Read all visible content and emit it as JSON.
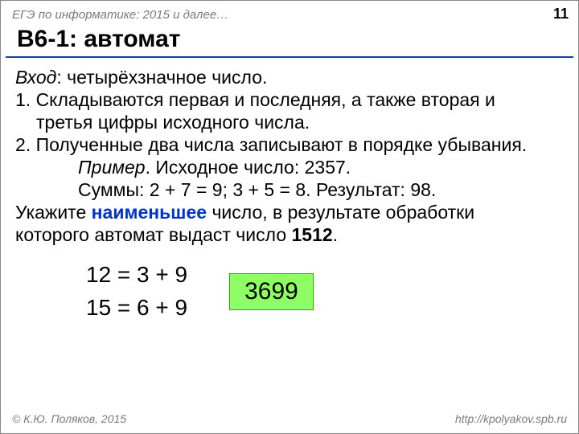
{
  "header": {
    "breadcrumb": "ЕГЭ по информатике: 2015 и далее…",
    "page_number": "11"
  },
  "title": "B6-1: автомат",
  "content": {
    "input_label": "Вход",
    "input_text": ": четырёхзначное число.",
    "step1a": "1. Складываются первая и последняя, а также вторая и",
    "step1b": "третья цифры исходного числа.",
    "step2": "2. Полученные два числа записывают в порядке убывания.",
    "example_label": "Пример",
    "example_text": ". Исходное число: 2357.",
    "sums_line": "Суммы: 2 + 7 = 9; 3 + 5 = 8. Результат: 98.",
    "task_a": "Укажите ",
    "task_hl": "наименьшее",
    "task_b": " число, в результате обработки",
    "task_c": "которого автомат выдаст число ",
    "task_num": "1512",
    "task_end": "."
  },
  "work": {
    "eq1": "12 = 3 + 9",
    "eq2": "15 = 6 + 9",
    "answer": "3699"
  },
  "footer": {
    "copyright": "© К.Ю. Поляков, 2015",
    "url": "http://kpolyakov.spb.ru"
  }
}
